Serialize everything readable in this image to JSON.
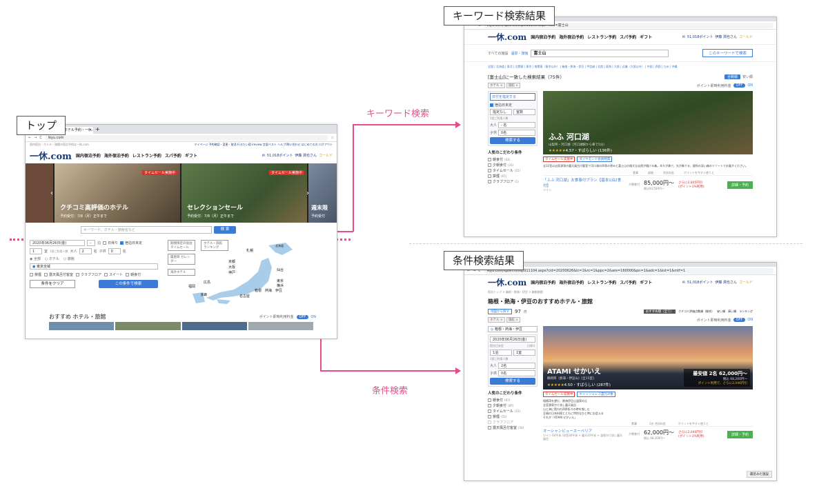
{
  "labels": {
    "top": "トップ",
    "keyword_result": "キーワード検索結果",
    "condition_result": "条件検索結果",
    "keyword_search": "キーワード検索",
    "condition_search": "条件検索"
  },
  "colors": {
    "accent": "#e84b8a",
    "brand": "#1a3b78",
    "blue": "#3a7bd5",
    "red": "#d9342b",
    "green": "#4caf50"
  },
  "top": {
    "tab": "一休.com ホテル予約・一休.com",
    "url": "ikyu.com",
    "logo": "一休.com",
    "nav": [
      "国内宿泊予約",
      "海外宿泊予約",
      "レストラン予約",
      "スパ予約",
      "ギフト"
    ],
    "points": "51,018ポイント",
    "user": "伊藤 潤也さん",
    "rank": "ゴールド",
    "breadcrumb": "国内宿泊・ホテル・旅館の宿泊予約は一休.com",
    "top_links": "マイページ 予約確認・変更・取消 行きたい宿 ireview 言語ベスト ヘルプ/問い合わせ はじめての方 ログアウト",
    "hero": [
      {
        "title": "クチコミ高評価のホテル",
        "sub": "予約受付：7/8（月）正午まで",
        "badge": "タイムセール実施中"
      },
      {
        "title": "セレクションセール",
        "sub": "予約受付：7/8（月）正午まで",
        "badge": "タイムセール実施中"
      },
      {
        "title": "週末限",
        "sub": "予約受付"
      }
    ],
    "search_placeholder": "キーワード、ホテル・旅館名など",
    "search_btn": "検 索",
    "date": "2020年06月26日(金)",
    "nights": "泊",
    "day_trip": "日帰り",
    "undecided": "宿泊日未定",
    "rooms": "1",
    "room_unit": "室",
    "per_room": "1室ご利用人数",
    "adult": "大人",
    "adult_val": "2",
    "child": "子供",
    "child_val": "0",
    "person": "名",
    "radio": [
      "全部",
      "ホテル",
      "旅館"
    ],
    "area": "東京全域",
    "filters": [
      "禁煙",
      "露天風呂付客室",
      "クラブフロア",
      "スイート",
      "朝食付"
    ],
    "clear_btn": "条件をクリア",
    "search_cond_btn": "この条件で検索",
    "map_buttons": [
      "期間限定の宿泊 タイムセール",
      "ホテル・旅館 ランキング",
      "履歴目 カレンダー",
      "海外ホテル"
    ],
    "map_labels": [
      "北海道",
      "札幌",
      "仙台",
      "東北",
      "京都",
      "大阪",
      "神戸",
      "広島",
      "福岡",
      "沖縄",
      "那覇",
      "九州",
      "四国",
      "中国",
      "関西",
      "北陸",
      "東海",
      "名古屋",
      "箱根",
      "熱海",
      "伊豆",
      "軽井沢",
      "東京",
      "横浜"
    ],
    "recommend": "おすすめ ホテル・旅館",
    "points_toggle": "ポイント即時利用料金",
    "off": "OFF",
    "on": "ON"
  },
  "kw": {
    "url": "ikyu.com/sp/srch/Usp911103.aspx?kwd=富士山",
    "category": "すべての施設",
    "category2": "温泉・旅館",
    "keyword": "富士山",
    "search_btn": "このキーワードで検索",
    "regions": "全国 | 北海道 | 東北 | 北関東 | 東京 | 南関東（東京以外） | 箱根・熱海・伊豆 | 甲信越 | 北陸 | 東海 | 大阪 | 近畿（大阪以外） | 中国 | 四国 | 九州 | 沖縄",
    "result_title": "[富士山]に一致した検索結果",
    "result_count": "（75件）",
    "sort1": "合致順",
    "sort2": "安い順",
    "tags": [
      "ホテル",
      "旅館"
    ],
    "date_btn": "日付を指定する",
    "undecided": "宿泊日未定",
    "room_lbl": "指定なし",
    "rooms_val": "室数",
    "per_room": "1室ご利用人数",
    "adult": "大人",
    "adult_val": "- 名",
    "child": "子供",
    "child_val": "0名",
    "search_btn2": "検索する",
    "pop_title": "人気のこだわり条件",
    "pop": [
      [
        "朝食付",
        "(43)"
      ],
      [
        "夕朝食付",
        "(31)"
      ],
      [
        "タイムセール",
        "(15)"
      ],
      [
        "禁煙",
        "(67)"
      ],
      [
        "クラブフロア",
        "(1)"
      ]
    ],
    "hotel_name": "ふふ 河口湖",
    "hotel_area": "山梨県・河口湖（河口湖駅から車で5分）",
    "rating": "4.57・すばらしい (136件)",
    "badges": [
      "タイムセール実施中",
      "ダイヤモンド会員特典"
    ],
    "desc": "全32室は自家源泉の露天風呂付客室で河口湖の四季の恵みと富士山の雄大な自然が覗ける森。木々が奏で、光が奏でる、寝所の深い森のリゾートでお寛ぎください。",
    "plan_head": [
      "食事",
      "部屋",
      "合計料金",
      "ポイントを今すぐ使うと"
    ],
    "plan": "「ふふ 河口湖」お食事付プラン【基本1泊2食付】",
    "plan_room": "ツイン",
    "meal": "2食",
    "room": "夕朝食付",
    "price": "85,000円〜",
    "tax": "税込93,500円〜",
    "discount": "さらに2,805円引",
    "discount2": "(ポイント3%利用)",
    "detail_btn": "詳細・予約",
    "points_toggle": "ポイント即時利用料金"
  },
  "cond": {
    "url": "ikyu.com/sp/srch/Usp911104.aspx?cid=20200626&lc=1&rc=1&ppc=2&are=160000&pn=1&adc=1&lst=1&mtf=1",
    "breadcrumb": "宿泊トップ > 箱根・熱海・伊豆 > 箱根旅館",
    "title": "箱根・熱海・伊豆のおすすめホテル・旅館",
    "map_link": "地図から探す",
    "count": "97",
    "count_unit": "件",
    "sort_sel": "おすすめ順（全て）",
    "sorts": [
      "クチコミ評価点数順（総合）",
      "安い順",
      "高い順",
      "ランキング"
    ],
    "tags": [
      "ホテル",
      "旅館"
    ],
    "points_toggle": "ポイント即時利用料金",
    "area": "箱根・熱海・伊豆",
    "date": "2020年06月26日(金)",
    "undecided": "宿泊日未定",
    "day_trip": "日帰り",
    "nights": "1泊",
    "rooms": "1室",
    "per_room": "1室ご利用人数",
    "adult": "大人",
    "adult_val": "2名",
    "child": "子供",
    "child_val": "0名",
    "search_btn": "検索する",
    "pop_title": "人気のこだわり条件",
    "pop": [
      [
        "朝食付",
        "(67)"
      ],
      [
        "夕朝食付",
        "(87)"
      ],
      [
        "タイムセール",
        "(21)"
      ],
      [
        "禁煙",
        "(53)"
      ],
      [
        "クラブフロア",
        ""
      ],
      [
        "露天風呂付客室",
        "(54)"
      ]
    ],
    "hotel_name": "ATAMI せかいえ",
    "hotel_area": "静岡県（熱海・伊豆山）[全15室]",
    "rating": "4.50・すばらしい (287件)",
    "price_box": "最安値 2名 62,000円〜",
    "price_tax": "税込 68,200円〜",
    "price_point": "ポイント利用で、さらに2,046円引",
    "badges": [
      "タイムセール実施中",
      "キャッシュレス還元対象"
    ],
    "desc": "相模湾を望む、熱海伊豆山温泉の丘\n全室源泉かけ流し露天風呂\n山と海に囲われ四季折々の時を愉しむ\n至福の日本料理とともに特別なひと時に出会える\nそれが「ATAMI せかいえ」",
    "plan_head": [
      "食事",
      "2名 合計料金",
      "ポイントを今すぐ使うと"
    ],
    "plan": "オーシャンビュースーペリア",
    "plan_sub": "ツイン 64平米 /洋室38平米 + 露天10平米 + 温泉かけ流し露天風呂",
    "room": "夕朝食付",
    "price": "62,000円〜",
    "tax": "税込 68,200円〜",
    "discount": "さらに2,046円引",
    "discount2": "(ポイント3%利用)",
    "detail_btn": "詳細・予約",
    "viewed": "最近みた施設"
  }
}
